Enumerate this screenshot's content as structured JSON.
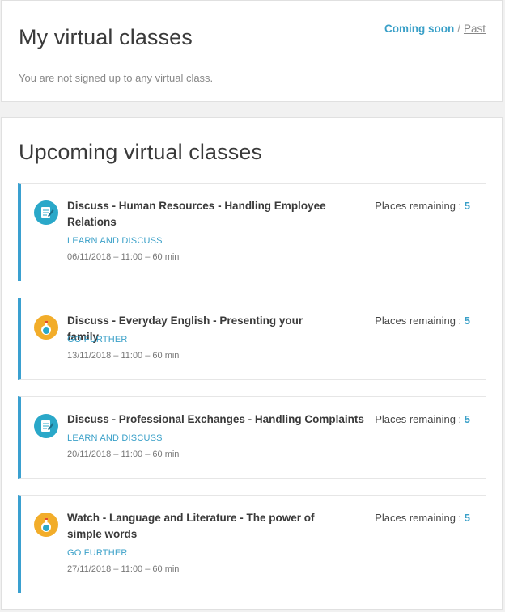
{
  "my_classes": {
    "title": "My virtual classes",
    "empty_message": "You are not signed up to any virtual class.",
    "filter": {
      "coming_soon": "Coming soon",
      "separator": "/",
      "past": "Past"
    }
  },
  "upcoming": {
    "title": "Upcoming virtual classes",
    "places_label": "Places remaining : ",
    "classes": [
      {
        "icon": "discuss-icon",
        "title": "Discuss - Human Resources - Handling Employee Relations",
        "category": "LEARN AND DISCUSS",
        "when": "06/11/2018 – 11:00 – 60 min",
        "places": "5"
      },
      {
        "icon": "go-further-icon",
        "title": "Discuss - Everyday English - Presenting your family",
        "category": "GO FURTHER",
        "when": "13/11/2018 – 11:00 – 60 min",
        "places": "5"
      },
      {
        "icon": "discuss-icon",
        "title": "Discuss - Professional Exchanges - Handling Complaints",
        "category": "LEARN AND DISCUSS",
        "when": "20/11/2018 – 11:00 – 60 min",
        "places": "5"
      },
      {
        "icon": "go-further-icon",
        "title": "Watch - Language and Literature - The power of simple words",
        "category": "GO FURTHER",
        "when": "27/11/2018 – 11:00 – 60 min",
        "places": "5"
      }
    ]
  },
  "colors": {
    "accent": "#3aa0c8",
    "discuss_icon_bg": "#2aa8c9",
    "further_icon_bg": "#f2ad2a"
  }
}
